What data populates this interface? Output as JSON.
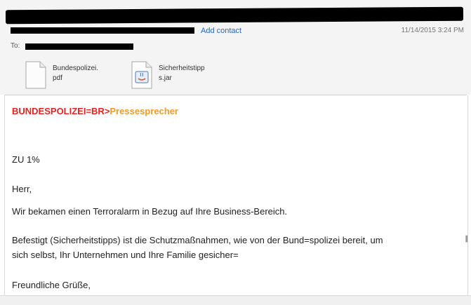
{
  "header": {
    "add_contact": "Add contact",
    "timestamp": "11/14/2015 3:24 PM",
    "to_label": "To:"
  },
  "attachments": [
    {
      "name": "Bundespolizei.\npdf",
      "icon": "pdf-file-icon"
    },
    {
      "name": "Sicherheitstipp\ns.jar",
      "icon": "java-file-icon"
    }
  ],
  "email": {
    "subject_red": "BUNDESPOLIZEI=BR",
    "subject_arrow": ">",
    "subject_orange": "Pressesprecher",
    "lines": [
      "ZU 1%",
      "Herr,",
      "Wir bekamen einen Terroralarm in Bezug auf Ihre Business-Bereich.",
      "Befestigt (Sicherheitstipps) ist die Schutzmaßnahmen, wie von der Bund=spolizei bereit, um",
      "sich selbst, Ihr Unternehmen und Ihre Familie gesicher=",
      "Freundliche Grüße,"
    ]
  },
  "colors": {
    "subject_red": "#e8231f",
    "subject_orange": "#f59a23",
    "link": "#2a64c8"
  }
}
